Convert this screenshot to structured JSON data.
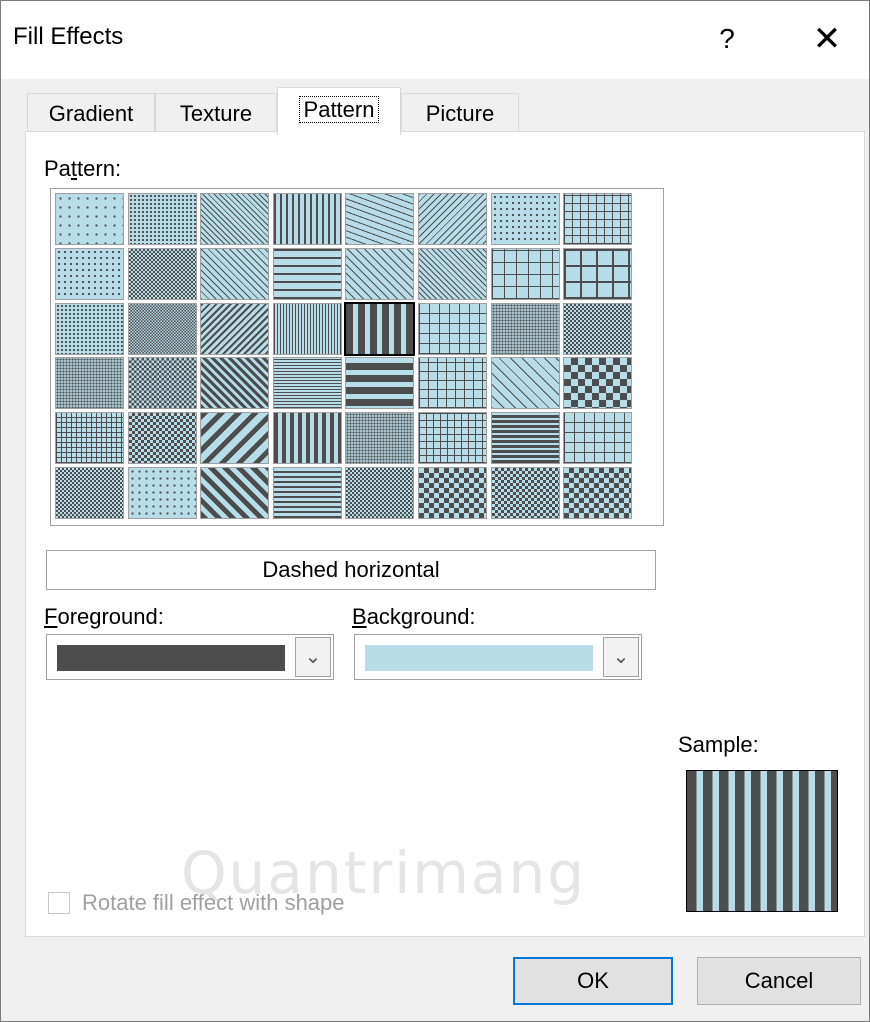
{
  "window": {
    "title": "Fill Effects",
    "help_glyph": "?",
    "close_glyph": "✕"
  },
  "tabs": [
    {
      "label": "Gradient",
      "active": false
    },
    {
      "label": "Texture",
      "active": false
    },
    {
      "label": "Pattern",
      "active": true
    },
    {
      "label": "Picture",
      "active": false
    }
  ],
  "pattern_section": {
    "label_pre": "Pa",
    "label_accel": "t",
    "label_post": "tern:",
    "selected_name": "Dashed horizontal",
    "foreground_color": "#4d4d4d",
    "background_color": "#b7dde8"
  },
  "foreground": {
    "label_accel": "F",
    "label_post": "oreground:",
    "color": "#4d4d4d",
    "arrow_icon": "chevron-down-icon"
  },
  "background": {
    "label_accel": "B",
    "label_post": "ackground:",
    "color": "#b7dde8",
    "arrow_icon": "chevron-down-icon"
  },
  "sample": {
    "label": "Sample:"
  },
  "rotate_option": {
    "label": "Rotate fill effect with shape",
    "checked": false,
    "enabled": false
  },
  "buttons": {
    "ok": "OK",
    "cancel": "Cancel"
  },
  "watermark": "Quantrimang",
  "colors": {
    "accent": "#0078d7",
    "dark": "#4d4d4d",
    "light": "#b7dde8"
  }
}
